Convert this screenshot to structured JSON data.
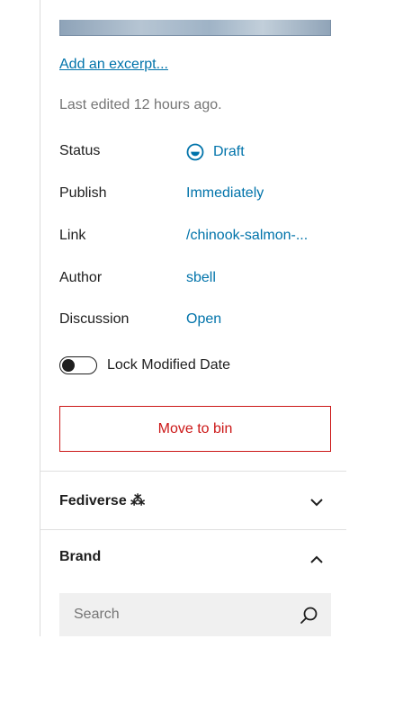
{
  "excerpt": {
    "link_label": "Add an excerpt..."
  },
  "last_edited": "Last edited 12 hours ago.",
  "post_settings": {
    "status": {
      "label": "Status",
      "value": "Draft"
    },
    "publish": {
      "label": "Publish",
      "value": "Immediately"
    },
    "link": {
      "label": "Link",
      "value": "/chinook-salmon-..."
    },
    "author": {
      "label": "Author",
      "value": "sbell"
    },
    "discussion": {
      "label": "Discussion",
      "value": "Open"
    }
  },
  "lock_modified_date": {
    "label": "Lock Modified Date",
    "enabled": false
  },
  "bin_button_label": "Move to bin",
  "sections": {
    "fediverse": {
      "title": "Fediverse ⁂",
      "expanded": false
    },
    "brand": {
      "title": "Brand",
      "expanded": true
    }
  },
  "brand_search": {
    "placeholder": "Search"
  },
  "colors": {
    "accent": "#0073aa",
    "danger": "#cc1818",
    "muted": "#757575"
  }
}
